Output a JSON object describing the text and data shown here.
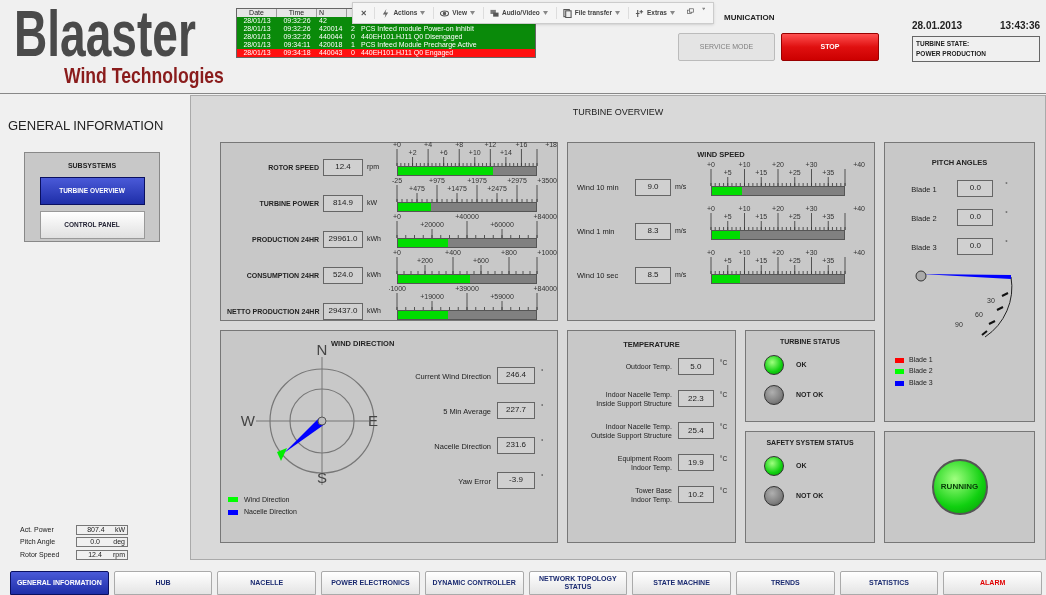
{
  "logo": {
    "name": "Blaaster",
    "tagline": "Wind Technologies"
  },
  "alarm_log": {
    "columns": [
      "Date",
      "Time",
      "N"
    ],
    "rows": [
      {
        "cells": [
          "28/01/13",
          "09:32:26",
          "42"
        ],
        "color": "#0a8a0a"
      },
      {
        "cells": [
          "28/01/13",
          "09:32:26",
          "420014",
          "2",
          "PCS Infeed module Power-on inhibit"
        ],
        "color": "#0a8a0a"
      },
      {
        "cells": [
          "28/01/13",
          "09:32:26",
          "440044",
          "0",
          "440EH101.HJ11 Q0 Disengaged"
        ],
        "color": "#0a8a0a"
      },
      {
        "cells": [
          "28/01/13",
          "09:34:11",
          "420018",
          "1",
          "PCS Infeed Module Precharge Active"
        ],
        "color": "#0a8a0a"
      },
      {
        "cells": [
          "28/01/13",
          "09:34:18",
          "440043",
          "0",
          "440EH101.HJ11 Q0 Engaged"
        ],
        "color": "#ff1010"
      }
    ]
  },
  "remote_toolbar": {
    "items": [
      {
        "label": "Actions",
        "kind": "bolt"
      },
      {
        "label": "View",
        "kind": "eye"
      },
      {
        "label": "Audio/Video",
        "kind": "chat"
      },
      {
        "label": "File transfer",
        "kind": "file"
      },
      {
        "label": "Extras",
        "kind": "extras"
      }
    ]
  },
  "header": {
    "communication_label": "MUNICATION",
    "service_button": {
      "label": "SERVICE MODE",
      "disabled": true
    },
    "stop_button": {
      "label": "STOP"
    },
    "date": "28.01.2013",
    "time": "13:43:36",
    "turbine_state": [
      "TURBINE STATE:",
      "POWER PRODUCTION"
    ]
  },
  "sidebar": {
    "title": "GENERAL INFORMATION",
    "subsystems": {
      "title": "SUBSYSTEMS",
      "items": [
        {
          "label": "TURBINE OVERVIEW",
          "selected": true
        },
        {
          "label": "CONTROL PANEL",
          "selected": false
        }
      ]
    },
    "readouts": [
      {
        "label": "Act. Power",
        "value": "807.4",
        "unit": "kW"
      },
      {
        "label": "Pitch Angle",
        "value": "0.0",
        "unit": "deg"
      },
      {
        "label": "Rotor Speed",
        "value": "12.4",
        "unit": "rpm"
      }
    ]
  },
  "overview": {
    "title": "TURBINE OVERVIEW",
    "measures": [
      {
        "label": "ROTOR SPEED",
        "value": "12.4",
        "unit": "rpm",
        "level": 0.69,
        "scale": [
          "+0",
          "+2",
          "+4",
          "+6",
          "+8",
          "+10",
          "+12",
          "+14",
          "+16",
          "+18"
        ]
      },
      {
        "label": "TURBINE POWER",
        "value": "814.9",
        "unit": "kW",
        "level": 0.24,
        "scale": [
          "-25",
          "+475",
          "+975",
          "+1475",
          "+1975",
          "+2475",
          "+2975",
          "+3500"
        ]
      },
      {
        "label": "PRODUCTION 24HR",
        "value": "29961.0",
        "unit": "kWh",
        "level": 0.36,
        "scale": [
          "+0",
          "+20000",
          "+40000",
          "+60000",
          "+84000"
        ]
      },
      {
        "label": "CONSUMPTION 24HR",
        "value": "524.0",
        "unit": "kWh",
        "level": 0.52,
        "scale": [
          "+0",
          "+200",
          "+400",
          "+600",
          "+800",
          "+1000"
        ]
      },
      {
        "label": "NETTO PRODUCTION 24HR",
        "value": "29437.0",
        "unit": "kWh",
        "level": 0.36,
        "scale": [
          "-1000",
          "+19000",
          "+39000",
          "+59000",
          "+84000"
        ]
      }
    ],
    "wind_speed": {
      "title": "WIND SPEED",
      "rows": [
        {
          "label": "Wind 10 min",
          "value": "9.0",
          "unit": "m/s",
          "level": 0.23,
          "scale": [
            "+0",
            "+5",
            "+10",
            "+15",
            "+20",
            "+25",
            "+30",
            "+35",
            "+40"
          ]
        },
        {
          "label": "Wind 1 min",
          "value": "8.3",
          "unit": "m/s",
          "level": 0.21,
          "scale": [
            "+0",
            "+5",
            "+10",
            "+15",
            "+20",
            "+25",
            "+30",
            "+35",
            "+40"
          ]
        },
        {
          "label": "Wind 10 sec",
          "value": "8.5",
          "unit": "m/s",
          "level": 0.21,
          "scale": [
            "+0",
            "+5",
            "+10",
            "+15",
            "+20",
            "+25",
            "+30",
            "+35",
            "+40"
          ]
        }
      ]
    },
    "pitch": {
      "title": "PITCH ANGLES",
      "blades": [
        {
          "label": "Blade 1",
          "value": "0.0",
          "unit": "°"
        },
        {
          "label": "Blade 2",
          "value": "0.0",
          "unit": "°"
        },
        {
          "label": "Blade 3",
          "value": "0.0",
          "unit": "°"
        }
      ],
      "dial_labels": [
        "30",
        "60",
        "90"
      ],
      "legend": [
        {
          "label": "Blade 1",
          "color": "#ff0000"
        },
        {
          "label": "Blade 2",
          "color": "#00ff00"
        },
        {
          "label": "Blade 3",
          "color": "#0000ff"
        }
      ]
    },
    "wind_direction": {
      "title": "WIND DIRECTION",
      "compass": [
        "N",
        "E",
        "S",
        "W"
      ],
      "readings": [
        {
          "label": "Current Wind Direction",
          "value": "246.4",
          "unit": "°"
        },
        {
          "label": "5 Min Average",
          "value": "227.7",
          "unit": "°"
        },
        {
          "label": "Nacelle Direction",
          "value": "231.6",
          "unit": "°"
        },
        {
          "label": "Yaw Error",
          "value": "-3.9",
          "unit": "°"
        }
      ],
      "legend": [
        {
          "label": "Wind Direction",
          "color": "#00ff00"
        },
        {
          "label": "Nacelle Direction",
          "color": "#0000ff"
        }
      ]
    },
    "temperature": {
      "title": "TEMPERATURE",
      "rows": [
        {
          "label_lines": [
            "Outdoor Temp."
          ],
          "value": "5.0",
          "unit": "°C"
        },
        {
          "label_lines": [
            "Indoor Nacelle Temp.",
            "Inside Support Structure"
          ],
          "value": "22.3",
          "unit": "°C"
        },
        {
          "label_lines": [
            "Indoor Nacelle Temp.",
            "Outside Support Structure"
          ],
          "value": "25.4",
          "unit": "°C"
        },
        {
          "label_lines": [
            "Equipment Room",
            "Indoor Temp."
          ],
          "value": "19.9",
          "unit": "°C"
        },
        {
          "label_lines": [
            "Tower Base",
            "Indoor Temp."
          ],
          "value": "10.2",
          "unit": "°C"
        }
      ]
    },
    "turbine_status": {
      "title": "TURBINE STATUS",
      "lamps": [
        {
          "label": "OK",
          "on": true
        },
        {
          "label": "NOT OK",
          "on": false
        }
      ]
    },
    "safety_status": {
      "title": "SAFETY SYSTEM STATUS",
      "lamps": [
        {
          "label": "OK",
          "on": true
        },
        {
          "label": "NOT OK",
          "on": false
        }
      ]
    },
    "running": {
      "label": "RUNNING",
      "on": true
    }
  },
  "tabs": [
    {
      "label": "GENERAL INFORMATION",
      "selected": true,
      "kind": "normal"
    },
    {
      "label": "HUB",
      "selected": false,
      "kind": "normal"
    },
    {
      "label": "NACELLE",
      "selected": false,
      "kind": "normal"
    },
    {
      "label": "POWER ELECTRONICS",
      "selected": false,
      "kind": "normal"
    },
    {
      "label": "DYNAMIC CONTROLLER",
      "selected": false,
      "kind": "normal"
    },
    {
      "label": "NETWORK TOPOLOGY STATUS",
      "selected": false,
      "kind": "normal"
    },
    {
      "label": "STATE MACHINE",
      "selected": false,
      "kind": "normal"
    },
    {
      "label": "TRENDS",
      "selected": false,
      "kind": "normal"
    },
    {
      "label": "STATISTICS",
      "selected": false,
      "kind": "normal"
    },
    {
      "label": "ALARM",
      "selected": false,
      "kind": "alarm"
    }
  ]
}
